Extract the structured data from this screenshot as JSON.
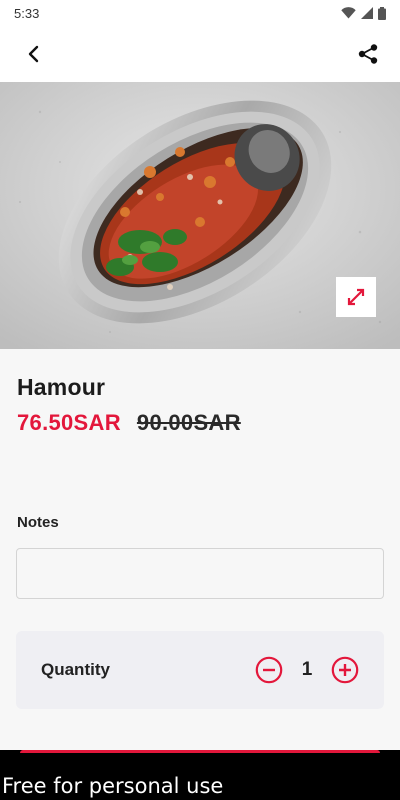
{
  "status_bar": {
    "time": "5:33"
  },
  "icons": {
    "back": "back-arrow-icon",
    "share": "share-icon",
    "expand": "expand-icon",
    "minus": "minus-circle-icon",
    "plus": "plus-circle-icon",
    "wifi": "wifi-icon",
    "signal": "cellular-signal-icon",
    "battery": "battery-icon"
  },
  "product": {
    "name": "Hamour",
    "price_current": "76.50SAR",
    "price_old": "90.00SAR",
    "image_alt": "Grilled hamour fish with tomato and herb topping in foil tray"
  },
  "notes": {
    "label": "Notes",
    "value": "",
    "placeholder": ""
  },
  "quantity": {
    "label": "Quantity",
    "value": "1"
  },
  "footer": {
    "watermark": "Free for personal use"
  },
  "colors": {
    "accent": "#e3173b",
    "background": "#f7f7f7",
    "card": "#efeff3"
  }
}
